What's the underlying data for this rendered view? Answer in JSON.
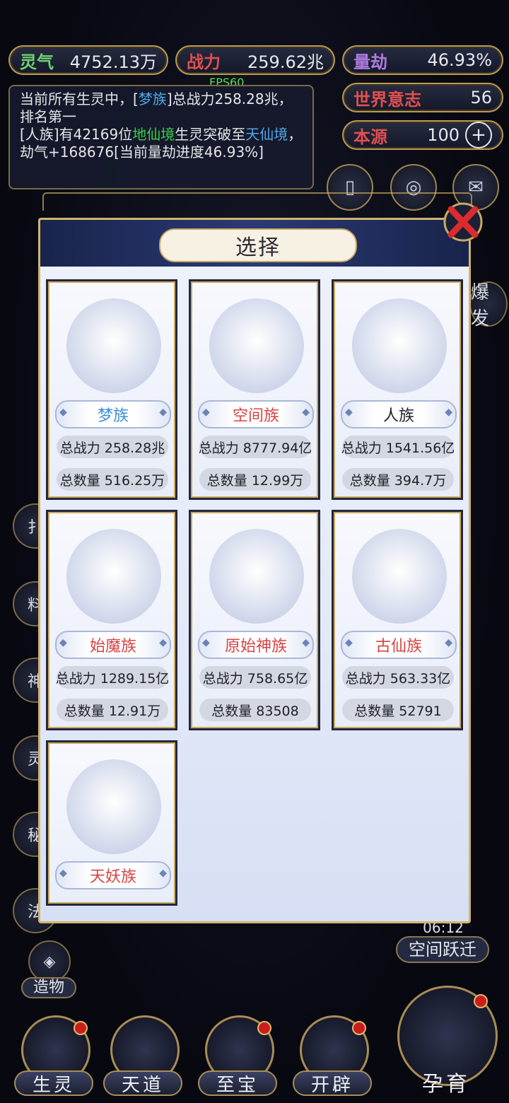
{
  "stats": {
    "lingqi_label": "灵气",
    "lingqi_value": "4752.13万",
    "zhanli_label": "战力",
    "zhanli_value": "259.62兆",
    "liangjie_label": "量劫",
    "liangjie_value": "46.93%",
    "shijie_label": "世界意志",
    "shijie_value": "56",
    "benyuan_label": "本源",
    "benyuan_value": "100"
  },
  "fps": "FPS60",
  "log": {
    "line1_a": "当前所有生灵中，[",
    "line1_b": "梦族",
    "line1_c": "]总战力258.28兆，排名第一",
    "line2_a": "[人族]有42169位",
    "line2_b": "地仙境",
    "line2_c": "生灵突破至",
    "line2_d": "天仙境",
    "line2_e": "，劫气+168676[当前量劫进度46.93%]"
  },
  "side": {
    "kongjian_timer": "06:12",
    "kongjian_label": "空间跃迁",
    "zaowu_label": "造物",
    "baofa_label": "爆发"
  },
  "modal": {
    "title": "选择",
    "races": [
      {
        "name": "梦族",
        "power": "总战力 258.28兆",
        "count": "总数量 516.25万",
        "color": "#3a8fd8"
      },
      {
        "name": "空间族",
        "power": "总战力 8777.94亿",
        "count": "总数量 12.99万",
        "color": "#d94343"
      },
      {
        "name": "人族",
        "power": "总战力 1541.56亿",
        "count": "总数量 394.7万",
        "color": "#222228"
      },
      {
        "name": "始魔族",
        "power": "总战力 1289.15亿",
        "count": "总数量 12.91万",
        "color": "#d94343"
      },
      {
        "name": "原始神族",
        "power": "总战力 758.65亿",
        "count": "总数量 83508",
        "color": "#d94343"
      },
      {
        "name": "古仙族",
        "power": "总战力 563.33亿",
        "count": "总数量 52791",
        "color": "#d94343"
      },
      {
        "name": "天妖族",
        "power": "",
        "count": "",
        "color": "#d94343"
      }
    ]
  },
  "nav": {
    "shengling": "生灵",
    "tiandao": "天道",
    "zhibao": "至宝",
    "kaipi": "开辟",
    "yunyu": "孕育"
  }
}
